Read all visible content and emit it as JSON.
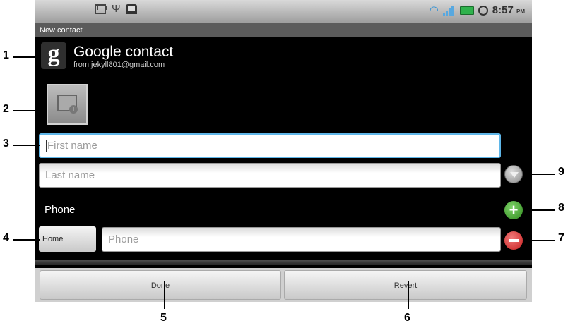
{
  "status_bar": {
    "time": "8:57",
    "ampm": "PM",
    "icons": [
      "gmail-icon",
      "usb-icon",
      "android-icon",
      "wifi-icon",
      "signal-icon",
      "battery-icon",
      "alarm-icon"
    ]
  },
  "title_bar": {
    "title": "New contact"
  },
  "account": {
    "logo_letter": "g",
    "name": "Google contact",
    "email": "from jekyll801@gmail.com"
  },
  "form": {
    "first_name_placeholder": "First name",
    "last_name_placeholder": "Last name",
    "phone_section_label": "Phone",
    "phone_type": "Home",
    "phone_placeholder": "Phone"
  },
  "actions": {
    "done_label": "Done",
    "revert_label": "Revert"
  },
  "callouts": [
    "1",
    "2",
    "3",
    "4",
    "5",
    "6",
    "7",
    "8",
    "9"
  ],
  "colors": {
    "focus_border": "#5fb6e8",
    "add_green": "#2f8a1d",
    "remove_red": "#c81e1e"
  }
}
